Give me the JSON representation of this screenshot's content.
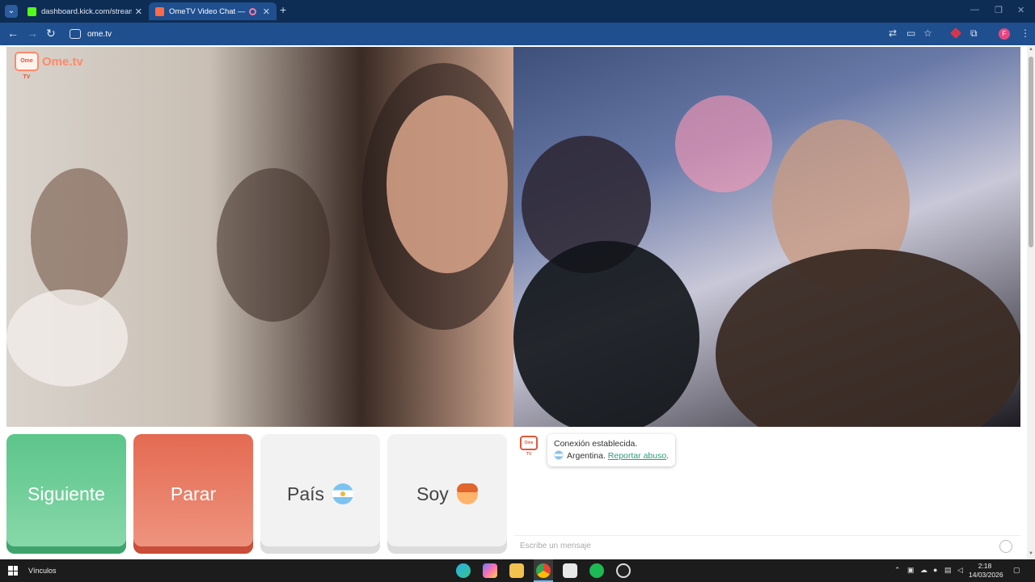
{
  "browser": {
    "tabs": [
      {
        "title": "dashboard.kick.com/stream",
        "active": false
      },
      {
        "title": "OmeTV Video Chat — Ome",
        "active": true
      }
    ],
    "address": "ome.tv",
    "profile_initial": "F"
  },
  "page": {
    "logo_text": "Ome.tv",
    "logo_badge": "Ome TV",
    "buttons": {
      "next": "Siguiente",
      "stop": "Parar",
      "country": "País",
      "gender": "Soy"
    },
    "chat": {
      "logo_badge": "Ome TV",
      "message_line1": "Conexión establecida.",
      "country": "Argentina.",
      "report_link": "Reportar abuso",
      "report_suffix": ".",
      "input_placeholder": "Escribe un mensaje"
    }
  },
  "taskbar": {
    "toolbar_label": "Vínculos",
    "time": "2:18",
    "date": "14/03/2026"
  },
  "colors": {
    "next_button": "#5cc58a",
    "stop_button": "#e46a52",
    "brand": "#ff8a6a"
  }
}
